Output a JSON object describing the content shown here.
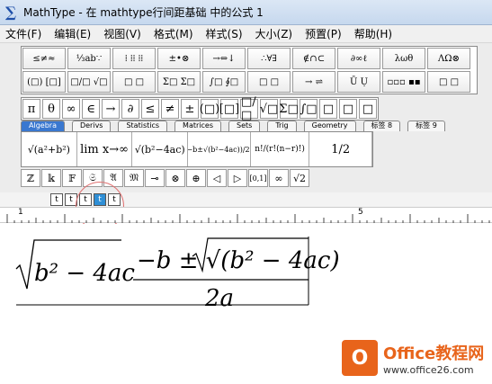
{
  "window": {
    "title": "MathType - 在 mathtype行间距基础 中的公式 1",
    "icon_glyph": "∑"
  },
  "menu": [
    "文件(F)",
    "编辑(E)",
    "视图(V)",
    "格式(M)",
    "样式(S)",
    "大小(Z)",
    "预置(P)",
    "帮助(H)"
  ],
  "palette_row1": [
    "≤≠≈",
    "⅓ab∵",
    "⁞ ⁞⁞ ⁞⁞",
    "±•⊗",
    "→⇔↓",
    "∴∀∃",
    "∉∩⊂",
    "∂∞ℓ",
    "λωθ",
    "ΛΩ⊗"
  ],
  "palette_row2": [
    "(□) [□]",
    "□/□ √□",
    "□ □",
    "Σ□ Σ□",
    "∫□ ∮□",
    "□ □",
    "→ ⇌",
    "Ū Ụ",
    "▫▫▫ ▪▪",
    "□ □"
  ],
  "symbols_row": [
    "π",
    "θ",
    "∞",
    "∈",
    "→",
    "∂",
    "≤",
    "≠",
    "±",
    "(□)",
    "[□]",
    "□/□",
    "√□",
    "Σ□",
    "∫□",
    "□",
    "□",
    "□"
  ],
  "tabs": [
    "Algebra",
    "Derivs",
    "Statistics",
    "Matrices",
    "Sets",
    "Trig",
    "Geometry",
    "标签 8",
    "标签 9"
  ],
  "active_tab": "Algebra",
  "templates": [
    "√(a²+b²)",
    "lim x→∞",
    "√(b²−4ac)",
    "(−b±√(b²−4ac))/2a",
    "n!/(r!(n−r)!)",
    "1/2"
  ],
  "small_row": [
    "ℤ",
    "𝕜",
    "𝔽",
    "𝔖",
    "𝔄",
    "𝔐",
    "⊸",
    "⊗",
    "⊕",
    "◁",
    "▷",
    "[0,1]",
    "∞",
    "√2"
  ],
  "size_buttons": [
    "t",
    "t",
    "t",
    "t",
    "t"
  ],
  "selected_size_index": 3,
  "ruler": {
    "labels": [
      "1",
      "5"
    ]
  },
  "equation": {
    "sqrt_radicand": "b² − 4ac",
    "numerator": "−b ± √(b² − 4ac)",
    "denominator": "2a"
  },
  "watermark": {
    "logo_glyph": "O",
    "line1": "Office教程网",
    "line2": "www.office26.com"
  },
  "colors": {
    "tab_active": "#3a78d0",
    "size_selected": "#2f8fd6",
    "watermark": "#e8641b"
  }
}
